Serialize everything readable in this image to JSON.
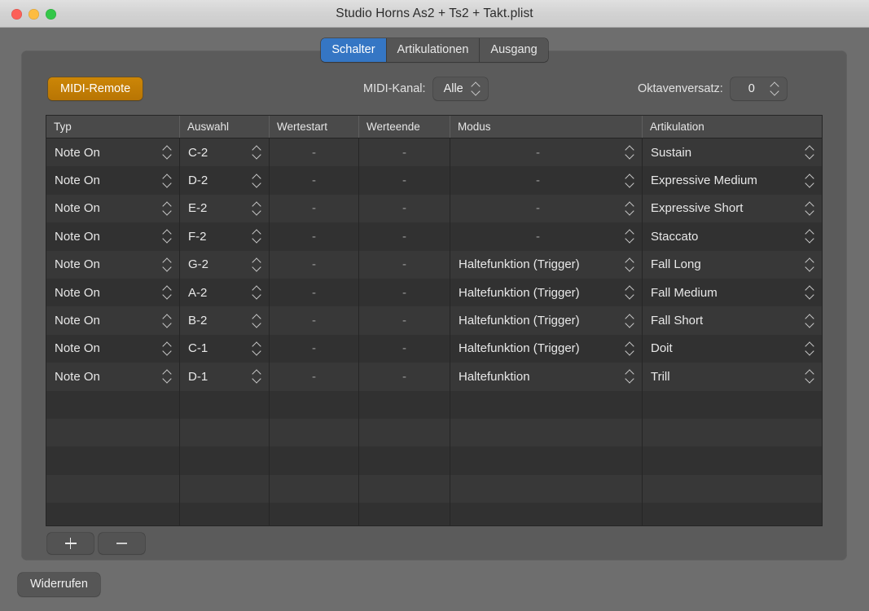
{
  "window": {
    "title": "Studio Horns As2 + Ts2 + Takt.plist",
    "traffic_lights": [
      "close",
      "minimize",
      "zoom"
    ]
  },
  "tabs": [
    {
      "label": "Schalter",
      "active": true
    },
    {
      "label": "Artikulationen",
      "active": false
    },
    {
      "label": "Ausgang",
      "active": false
    }
  ],
  "toolbar": {
    "midi_remote_label": "MIDI-Remote",
    "midi_remote_color": "#c08204",
    "midi_channel_label": "MIDI-Kanal:",
    "midi_channel_value": "Alle",
    "octave_offset_label": "Oktavenversatz:",
    "octave_offset_value": "0"
  },
  "table": {
    "columns": [
      "Typ",
      "Auswahl",
      "Wertestart",
      "Werteende",
      "Modus",
      "Artikulation"
    ],
    "rows": [
      {
        "typ": "Note On",
        "auswahl": "C-2",
        "wertestart": "-",
        "werteende": "-",
        "modus": "-",
        "artikulation": "Sustain"
      },
      {
        "typ": "Note On",
        "auswahl": "D-2",
        "wertestart": "-",
        "werteende": "-",
        "modus": "-",
        "artikulation": "Expressive Medium"
      },
      {
        "typ": "Note On",
        "auswahl": "E-2",
        "wertestart": "-",
        "werteende": "-",
        "modus": "-",
        "artikulation": "Expressive Short"
      },
      {
        "typ": "Note On",
        "auswahl": "F-2",
        "wertestart": "-",
        "werteende": "-",
        "modus": "-",
        "artikulation": "Staccato"
      },
      {
        "typ": "Note On",
        "auswahl": "G-2",
        "wertestart": "-",
        "werteende": "-",
        "modus": "Haltefunktion (Trigger)",
        "artikulation": "Fall Long"
      },
      {
        "typ": "Note On",
        "auswahl": "A-2",
        "wertestart": "-",
        "werteende": "-",
        "modus": "Haltefunktion (Trigger)",
        "artikulation": "Fall Medium"
      },
      {
        "typ": "Note On",
        "auswahl": "B-2",
        "wertestart": "-",
        "werteende": "-",
        "modus": "Haltefunktion (Trigger)",
        "artikulation": "Fall Short"
      },
      {
        "typ": "Note On",
        "auswahl": "C-1",
        "wertestart": "-",
        "werteende": "-",
        "modus": "Haltefunktion (Trigger)",
        "artikulation": "Doit"
      },
      {
        "typ": "Note On",
        "auswahl": "D-1",
        "wertestart": "-",
        "werteende": "-",
        "modus": "Haltefunktion",
        "artikulation": "Trill"
      }
    ],
    "empty_row_count": 5
  },
  "table_buttons": {
    "add_label": "+",
    "remove_label": "–"
  },
  "footer": {
    "undo_label": "Widerrufen"
  },
  "colors": {
    "accent_tab": "#3576c4",
    "accent_button": "#c08204",
    "window_background": "#6e6e6e",
    "panel_background": "#5b5b5b",
    "table_background": "#343434"
  }
}
